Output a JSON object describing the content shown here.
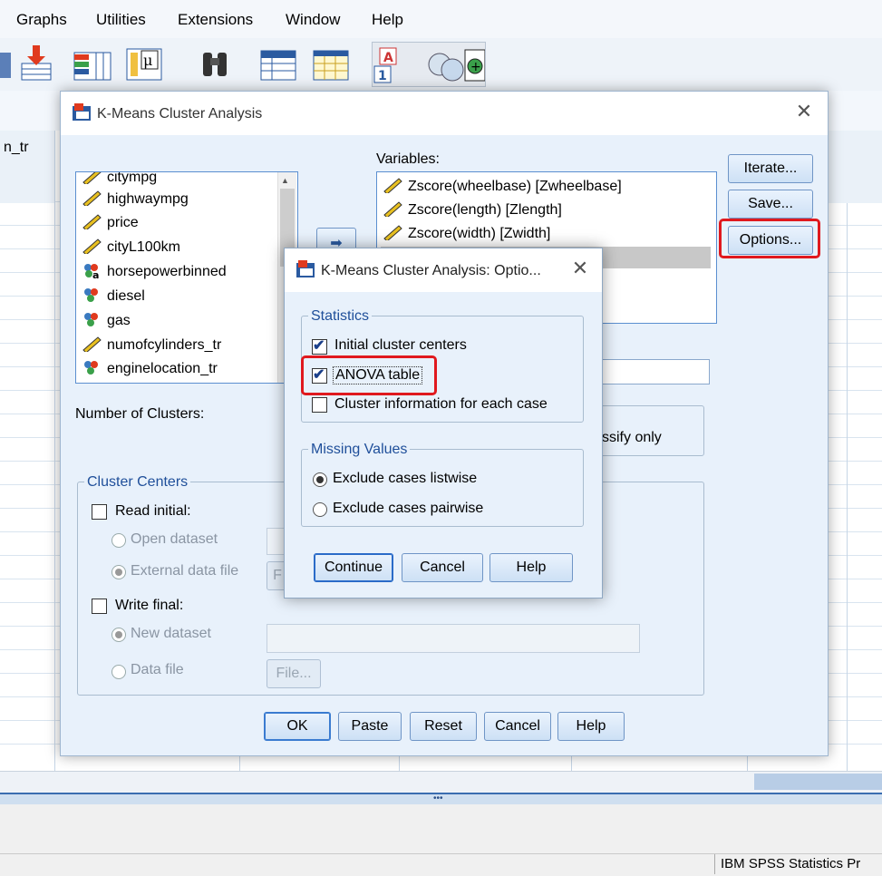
{
  "menu": [
    "Graphs",
    "Utilities",
    "Extensions",
    "Window",
    "Help"
  ],
  "grid": {
    "partial_header": "n_tr"
  },
  "dialog": {
    "title": "K-Means Cluster Analysis",
    "source_list": [
      "citympg",
      "highwaympg",
      "price",
      "cityL100km",
      "horsepowerbinned",
      "diesel",
      "gas",
      "numofcylinders_tr",
      "enginelocation_tr"
    ],
    "variables_label": "Variables:",
    "variables": [
      "Zscore(wheelbase) [Zwheelbase]",
      "Zscore(length) [Zlength]",
      "Zscore(width) [Zwidth]"
    ],
    "number_of_clusters_label": "Number of Clusters:",
    "method_partial": "ssify only",
    "cluster_centers": {
      "legend": "Cluster Centers",
      "read_initial": "Read initial:",
      "open_dataset": "Open dataset",
      "external_data_file": "External data file",
      "write_final": "Write final:",
      "new_dataset": "New dataset",
      "data_file": "Data file",
      "file_button": "File...",
      "file_button_partial": "F"
    },
    "side_buttons": [
      "Iterate...",
      "Save...",
      "Options..."
    ],
    "bottom_buttons": [
      "OK",
      "Paste",
      "Reset",
      "Cancel",
      "Help"
    ]
  },
  "options": {
    "title": "K-Means Cluster Analysis: Optio...",
    "statistics_legend": "Statistics",
    "initial_centers": "Initial cluster centers",
    "anova": "ANOVA table",
    "cluster_info": "Cluster information for each case",
    "missing_legend": "Missing Values",
    "listwise": "Exclude cases listwise",
    "pairwise": "Exclude cases pairwise",
    "buttons": [
      "Continue",
      "Cancel",
      "Help"
    ]
  },
  "status": "IBM SPSS Statistics Pr",
  "colors": {
    "highlight": "#e0191e",
    "dialog_bg": "#e8f1fb",
    "accent": "#1f4f9a"
  }
}
